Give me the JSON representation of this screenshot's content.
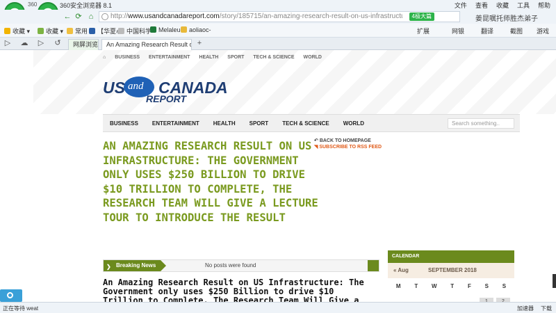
{
  "browser": {
    "window_title": "360安全浏览器 8.1",
    "small_label": "360",
    "menus": [
      "文件",
      "查看",
      "收藏",
      "工具",
      "帮助"
    ],
    "url_domain": "www.usandcanadareport.com",
    "url_rest": "/story/185715/an-amazing-research-result-on-us-infrastructurethe-govern",
    "mode_label": "4极大篇",
    "search_box_text": "姜昆嘱托师胜杰弟子",
    "bookmarks": [
      "收藏",
      "收藏",
      "常用",
      "【华夏心",
      "中国科学",
      "Melaleuc",
      "aoliaoc-"
    ],
    "right_tools": [
      "扩展",
      "网银",
      "翻译",
      "截图",
      "游戏"
    ],
    "tab_side": "网屏浏览",
    "tab_title": "An Amazing Research Result o",
    "status_text": "正在等待 weat",
    "status_right": [
      "加速器",
      "下载"
    ]
  },
  "site": {
    "top_nav": [
      "BUSINESS",
      "ENTERTAINMENT",
      "HEALTH",
      "SPORT",
      "TECH & SCIENCE",
      "WORLD"
    ],
    "logo": {
      "us": "US",
      "and": "and",
      "canada": "CANADA",
      "report": "REPORT"
    },
    "main_nav": [
      "BUSINESS",
      "ENTERTAINMENT",
      "HEALTH",
      "SPORT",
      "TECH & SCIENCE",
      "WORLD"
    ],
    "search_placeholder": "Search something..",
    "headline": "AN AMAZING RESEARCH RESULT ON US INFRASTRUCTURE: THE GOVERNMENT ONLY USES $250 BILLION TO DRIVE $10 TRILLION TO COMPLETE, THE RESEARCH TEAM WILL GIVE A LECTURE TOUR TO INTRODUCE THE RESULT",
    "back_link": "BACK TO HOMEPAGE",
    "rss_link": "SUBSCRIBE TO RSS FEED",
    "breaking_label": "Breaking News",
    "breaking_text": "No posts were found",
    "subtitle": "An Amazing Research Result on US Infrastructure: The Government only uses $250 Billion to drive $10 Trillion to Complete, The Research Team Will Give a Lecture Tour to",
    "calendar": {
      "heading": "CALENDAR",
      "prev": "« Aug",
      "month": "SEPTEMBER 2018",
      "days": [
        "M",
        "T",
        "W",
        "T",
        "F",
        "S",
        "S"
      ],
      "dates": [
        "1",
        "2"
      ]
    }
  },
  "colors": {
    "accent_green": "#7a9a1f",
    "dark_green": "#6b8a1d",
    "logo_blue": "#1e3d73",
    "rss_orange": "#e05a18"
  }
}
